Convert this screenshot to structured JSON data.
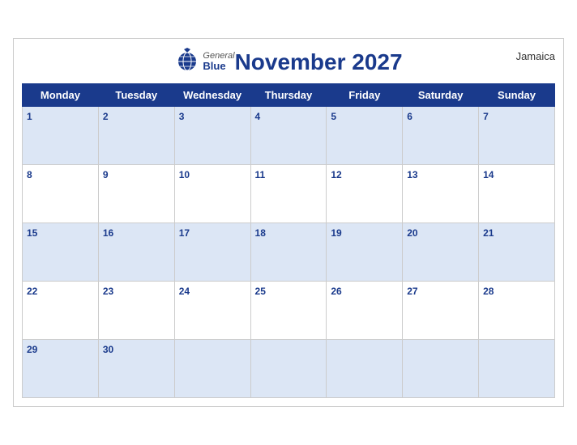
{
  "calendar": {
    "title": "November 2027",
    "country": "Jamaica",
    "days_of_week": [
      "Monday",
      "Tuesday",
      "Wednesday",
      "Thursday",
      "Friday",
      "Saturday",
      "Sunday"
    ],
    "weeks": [
      {
        "row_style": "blue",
        "days": [
          {
            "date": "1",
            "empty": false
          },
          {
            "date": "2",
            "empty": false
          },
          {
            "date": "3",
            "empty": false
          },
          {
            "date": "4",
            "empty": false
          },
          {
            "date": "5",
            "empty": false
          },
          {
            "date": "6",
            "empty": false
          },
          {
            "date": "7",
            "empty": false
          }
        ]
      },
      {
        "row_style": "white",
        "days": [
          {
            "date": "8",
            "empty": false
          },
          {
            "date": "9",
            "empty": false
          },
          {
            "date": "10",
            "empty": false
          },
          {
            "date": "11",
            "empty": false
          },
          {
            "date": "12",
            "empty": false
          },
          {
            "date": "13",
            "empty": false
          },
          {
            "date": "14",
            "empty": false
          }
        ]
      },
      {
        "row_style": "blue",
        "days": [
          {
            "date": "15",
            "empty": false
          },
          {
            "date": "16",
            "empty": false
          },
          {
            "date": "17",
            "empty": false
          },
          {
            "date": "18",
            "empty": false
          },
          {
            "date": "19",
            "empty": false
          },
          {
            "date": "20",
            "empty": false
          },
          {
            "date": "21",
            "empty": false
          }
        ]
      },
      {
        "row_style": "white",
        "days": [
          {
            "date": "22",
            "empty": false
          },
          {
            "date": "23",
            "empty": false
          },
          {
            "date": "24",
            "empty": false
          },
          {
            "date": "25",
            "empty": false
          },
          {
            "date": "26",
            "empty": false
          },
          {
            "date": "27",
            "empty": false
          },
          {
            "date": "28",
            "empty": false
          }
        ]
      },
      {
        "row_style": "blue",
        "days": [
          {
            "date": "29",
            "empty": false
          },
          {
            "date": "30",
            "empty": false
          },
          {
            "date": "",
            "empty": true
          },
          {
            "date": "",
            "empty": true
          },
          {
            "date": "",
            "empty": true
          },
          {
            "date": "",
            "empty": true
          },
          {
            "date": "",
            "empty": true
          }
        ]
      }
    ],
    "logo": {
      "general": "General",
      "blue": "Blue"
    },
    "colors": {
      "header_bg": "#1a3a8c",
      "row_blue": "#dce6f5",
      "row_white": "#ffffff",
      "day_number": "#1a3a8c"
    }
  }
}
